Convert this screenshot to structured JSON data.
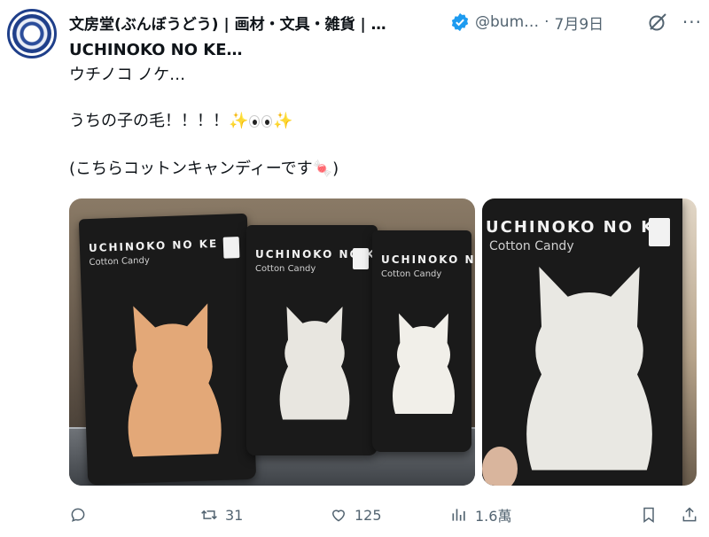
{
  "post": {
    "display_name": "文房堂(ぶんぼうどう) | 画材・文具・雑貨 | …",
    "handle": "@bum…",
    "separator": "·",
    "date": "7月9日",
    "more": "···",
    "lines": [
      "UCHINOKO NO KE…",
      "ウチノコ ノケ…",
      "うちの子の毛！！！！",
      "(こちらコットンキャンディーです"
    ],
    "line3_close": ")",
    "emoji": {
      "sparkle": "✨",
      "candy": "🍬"
    }
  },
  "media": {
    "left_bags": [
      {
        "brand": "UCHINOKO NO KE",
        "sub": "Cotton Candy"
      },
      {
        "brand": "UCHINOKO NO KE",
        "sub": "Cotton Candy"
      },
      {
        "brand": "UCHINOKO NO KE",
        "sub": "Cotton Candy"
      }
    ],
    "right_bag": {
      "brand": "UCHINOKO NO KE",
      "sub": "Cotton Candy"
    }
  },
  "actions": {
    "reply_count": "",
    "retweet_count": "31",
    "like_count": "125",
    "view_count": "1.6萬"
  },
  "colors": {
    "verified": "#1d9bf0",
    "muted": "#536471",
    "text": "#0f1419"
  }
}
